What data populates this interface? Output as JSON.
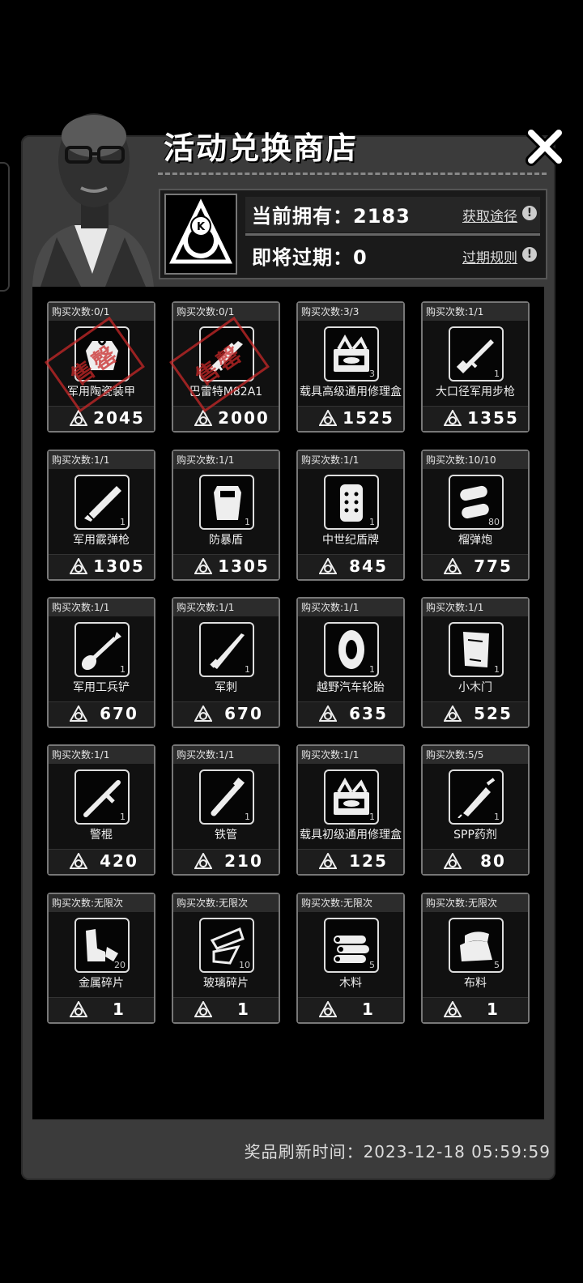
{
  "shop": {
    "title": "活动兑换商店",
    "owned_label": "当前拥有：2183",
    "expiring_label": "即将过期：0",
    "get_link": "获取途径",
    "expire_link": "过期规则",
    "refresh_label": "奖品刷新时间：",
    "refresh_time": "2023-12-18 05:59:59",
    "stamp_text": "售罄"
  },
  "items": [
    {
      "purchase": "购买次数:0/1",
      "name": "军用陶瓷装甲",
      "price": "2045",
      "qty": "",
      "icon": "armor-icon",
      "sold_out": true
    },
    {
      "purchase": "购买次数:0/1",
      "name": "巴雷特M82A1",
      "price": "2000",
      "qty": "",
      "icon": "sniper-rifle-icon",
      "sold_out": true
    },
    {
      "purchase": "购买次数:3/3",
      "name": "载具高级通用修理盒",
      "price": "1525",
      "qty": "3",
      "icon": "repair-box-icon",
      "sold_out": false
    },
    {
      "purchase": "购买次数:1/1",
      "name": "大口径军用步枪",
      "price": "1355",
      "qty": "1",
      "icon": "rifle-icon",
      "sold_out": false
    },
    {
      "purchase": "购买次数:1/1",
      "name": "军用霰弹枪",
      "price": "1305",
      "qty": "1",
      "icon": "shotgun-icon",
      "sold_out": false
    },
    {
      "purchase": "购买次数:1/1",
      "name": "防暴盾",
      "price": "1305",
      "qty": "1",
      "icon": "riot-shield-icon",
      "sold_out": false
    },
    {
      "purchase": "购买次数:1/1",
      "name": "中世纪盾牌",
      "price": "845",
      "qty": "1",
      "icon": "medieval-shield-icon",
      "sold_out": false
    },
    {
      "purchase": "购买次数:10/10",
      "name": "榴弹炮",
      "price": "775",
      "qty": "80",
      "icon": "shells-icon",
      "sold_out": false
    },
    {
      "purchase": "购买次数:1/1",
      "name": "军用工兵铲",
      "price": "670",
      "qty": "1",
      "icon": "shovel-icon",
      "sold_out": false
    },
    {
      "purchase": "购买次数:1/1",
      "name": "军刺",
      "price": "670",
      "qty": "1",
      "icon": "bayonet-icon",
      "sold_out": false
    },
    {
      "purchase": "购买次数:1/1",
      "name": "越野汽车轮胎",
      "price": "635",
      "qty": "1",
      "icon": "tire-icon",
      "sold_out": false
    },
    {
      "purchase": "购买次数:1/1",
      "name": "小木门",
      "price": "525",
      "qty": "1",
      "icon": "wooden-door-icon",
      "sold_out": false
    },
    {
      "purchase": "购买次数:1/1",
      "name": "警棍",
      "price": "420",
      "qty": "1",
      "icon": "baton-icon",
      "sold_out": false
    },
    {
      "purchase": "购买次数:1/1",
      "name": "铁管",
      "price": "210",
      "qty": "1",
      "icon": "iron-pipe-icon",
      "sold_out": false
    },
    {
      "purchase": "购买次数:1/1",
      "name": "载具初级通用修理盒",
      "price": "125",
      "qty": "1",
      "icon": "repair-box-icon",
      "sold_out": false
    },
    {
      "purchase": "购买次数:5/5",
      "name": "SPP药剂",
      "price": "80",
      "qty": "1",
      "icon": "syringe-icon",
      "sold_out": false
    },
    {
      "purchase": "购买次数:无限次",
      "name": "金属碎片",
      "price": "1",
      "qty": "20",
      "icon": "metal-scrap-icon",
      "sold_out": false
    },
    {
      "purchase": "购买次数:无限次",
      "name": "玻璃碎片",
      "price": "1",
      "qty": "10",
      "icon": "glass-shard-icon",
      "sold_out": false
    },
    {
      "purchase": "购买次数:无限次",
      "name": "木料",
      "price": "1",
      "qty": "5",
      "icon": "wood-logs-icon",
      "sold_out": false
    },
    {
      "purchase": "购买次数:无限次",
      "name": "布料",
      "price": "1",
      "qty": "5",
      "icon": "cloth-icon",
      "sold_out": false
    }
  ]
}
